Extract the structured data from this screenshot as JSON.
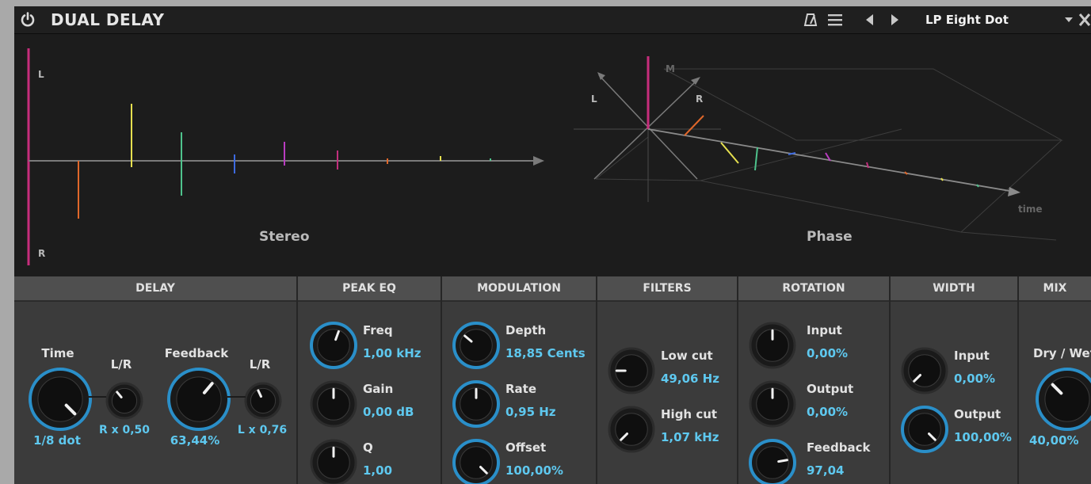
{
  "header": {
    "title": "DUAL DELAY",
    "preset": "LP Eight Dot",
    "icons": [
      "power-icon",
      "metronome-icon",
      "menu-icon",
      "prev-preset-icon",
      "next-preset-icon",
      "dropdown-icon",
      "close-icon"
    ]
  },
  "viz": {
    "stereo": {
      "label": "Stereo",
      "left": "L",
      "right": "R"
    },
    "phase": {
      "label": "Phase",
      "m": "M",
      "l": "L",
      "r": "R",
      "time": "time"
    }
  },
  "colors": {
    "accent": "#5ec8ef",
    "knob_ring": "#2a8fc9",
    "header_bg": "#4f4f4f",
    "panel_bg": "#3b3b3b"
  },
  "sections": {
    "delay": {
      "header": "DELAY",
      "time": {
        "label": "Time",
        "value": "1/8 dot"
      },
      "time_lr": {
        "label": "L/R",
        "value": "R x 0,50"
      },
      "feedback": {
        "label": "Feedback",
        "value": "63,44%"
      },
      "feedback_lr": {
        "label": "L/R",
        "value": "L x 0,76"
      }
    },
    "peak_eq": {
      "header": "PEAK EQ",
      "freq": {
        "label": "Freq",
        "value": "1,00 kHz"
      },
      "gain": {
        "label": "Gain",
        "value": "0,00 dB"
      },
      "q": {
        "label": "Q",
        "value": "1,00"
      }
    },
    "modulation": {
      "header": "MODULATION",
      "depth": {
        "label": "Depth",
        "value": "18,85 Cents"
      },
      "rate": {
        "label": "Rate",
        "value": "0,95 Hz"
      },
      "offset": {
        "label": "Offset",
        "value": "100,00%"
      }
    },
    "filters": {
      "header": "FILTERS",
      "low_cut": {
        "label": "Low cut",
        "value": "49,06 Hz"
      },
      "high_cut": {
        "label": "High cut",
        "value": "1,07 kHz"
      }
    },
    "rotation": {
      "header": "ROTATION",
      "input": {
        "label": "Input",
        "value": "0,00%"
      },
      "output": {
        "label": "Output",
        "value": "0,00%"
      },
      "feedback": {
        "label": "Feedback",
        "value": "97,04"
      }
    },
    "width": {
      "header": "WIDTH",
      "input": {
        "label": "Input",
        "value": "0,00%"
      },
      "output": {
        "label": "Output",
        "value": "100,00%"
      }
    },
    "mix": {
      "header": "MIX",
      "dry_wet": {
        "label": "Dry / Wet",
        "value": "40,00%"
      }
    }
  }
}
